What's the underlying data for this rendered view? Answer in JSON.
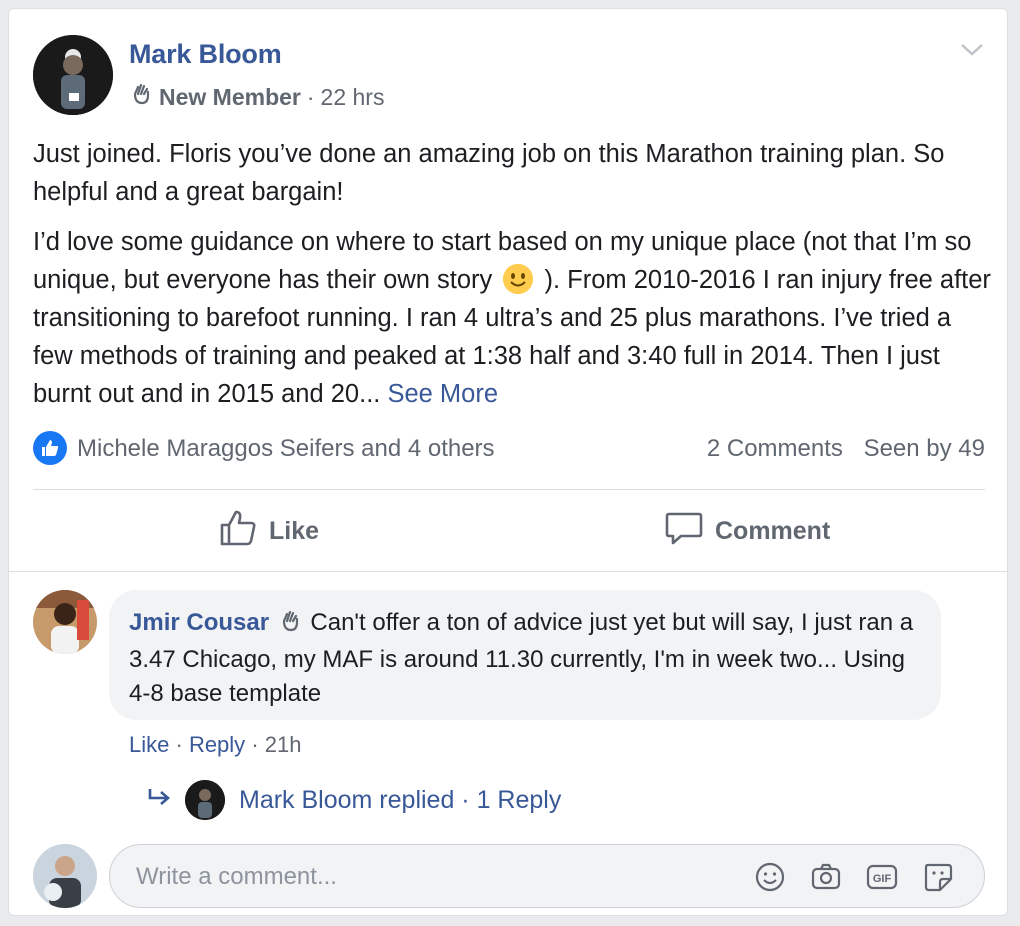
{
  "post": {
    "author": "Mark Bloom",
    "badge": "New Member",
    "time": "22 hrs",
    "paragraph1": "Just joined. Floris you’ve done an amazing job on this Marathon training plan. So helpful and a great bargain!",
    "paragraph2_before_emoji": "I’d love some guidance on where to start based on my unique place (not that I’m so unique, but everyone has their own story",
    "paragraph2_after_emoji": "). From 2010-2016 I ran injury free after transitioning to barefoot running. I ran 4 ultra’s and 25 plus marathons. I’ve tried a few methods of training and peaked at 1:38 half and 3:40 full in 2014. Then I just burnt out and in 2015 and 20...",
    "see_more": "See More"
  },
  "reactions": {
    "reactors": "Michele Maraggos Seifers and 4 others",
    "comments": "2 Comments",
    "seen": "Seen by 49"
  },
  "actions": {
    "like": "Like",
    "comment": "Comment"
  },
  "comment": {
    "author": "Jmir Cousar",
    "text": "Can't offer a ton of advice just yet but will say, I just ran a 3.47 Chicago, my MAF is around 11.30 currently, I'm in week two... Using 4-8 base template",
    "like": "Like",
    "reply": "Reply",
    "time": "21h",
    "replies_label": "Mark Bloom replied · 1 Reply"
  },
  "composer": {
    "placeholder": "Write a comment..."
  },
  "icons": {
    "chevron": "chevron-down-icon",
    "badge": "waving-hand-icon",
    "like_reaction": "thumbs-up-icon",
    "reply_arrow": "reply-arrow-icon",
    "tools": [
      "emoji-icon",
      "camera-icon",
      "gif-icon",
      "sticker-icon"
    ]
  },
  "colors": {
    "link": "#385898",
    "secondary": "#606770",
    "like_blue": "#1877f2"
  }
}
